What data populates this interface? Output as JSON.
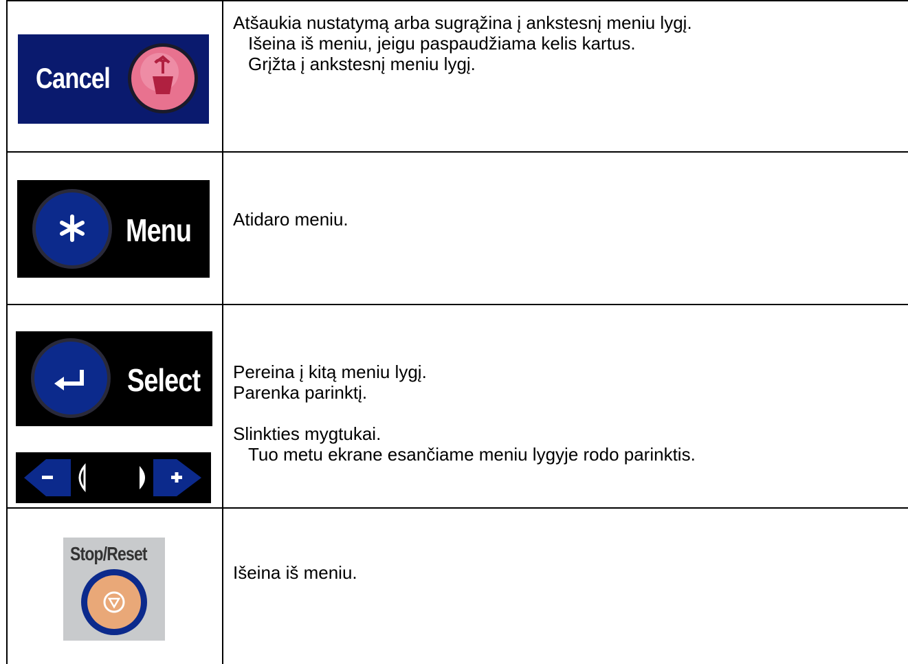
{
  "rows": [
    {
      "button_label": "Cancel",
      "icon": "cancel-bin-icon",
      "lines": [
        "Atšaukia nustatymą arba sugrąžina į ankstesnį meniu lygį.",
        "Išeina iš meniu, jeigu paspaudžiama kelis kartus.",
        "Grįžta į ankstesnį meniu lygį."
      ]
    },
    {
      "button_label": "Menu",
      "icon": "asterisk-icon",
      "lines": [
        "Atidaro meniu."
      ]
    },
    {
      "button_label": "Select",
      "icon": "enter-arrow-icon",
      "scroll_minus": "−",
      "scroll_plus": "+",
      "lines": [
        "Pereina į kitą meniu lygį.",
        "Parenka parinktį.",
        "Slinkties mygtukai.",
        "Tuo metu ekrane esančiame meniu lygyje rodo parinktis."
      ]
    },
    {
      "button_label": "Stop/Reset",
      "icon": "stop-icon",
      "lines": [
        "Išeina iš meniu."
      ]
    }
  ],
  "colors": {
    "cancel_bg": "#0a1a6e",
    "cancel_button": "#e8728f",
    "dark_panel": "#000000",
    "blue_button": "#0c2a8c",
    "stop_bg": "#c8cacc",
    "stop_button": "#e9a878"
  }
}
